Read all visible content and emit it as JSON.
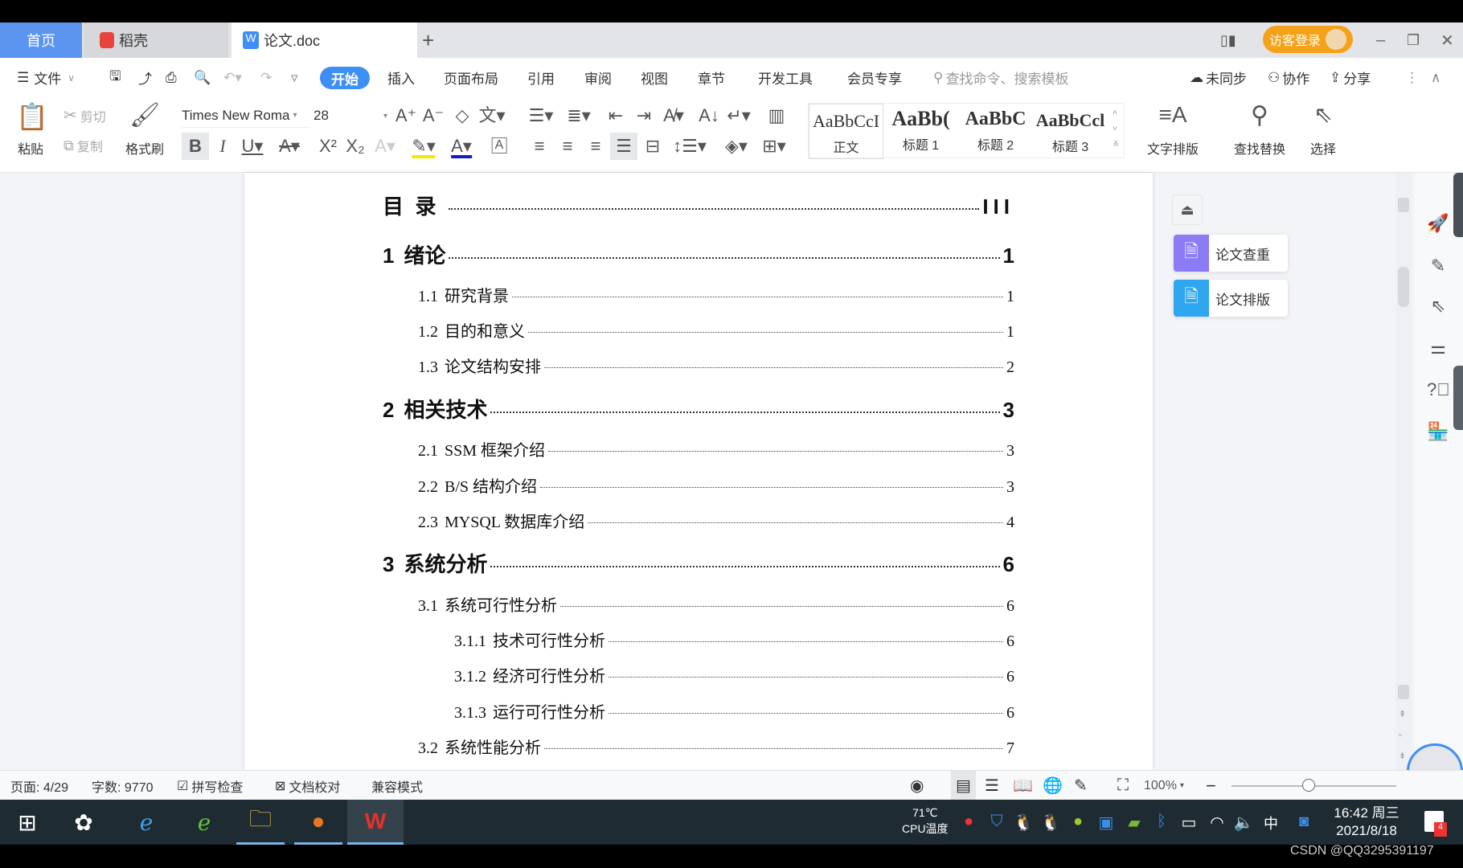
{
  "tabs": {
    "home": "首页",
    "docer": "稻壳",
    "doc": "论文.doc",
    "new": "+",
    "login": "访客登录"
  },
  "menu": {
    "file": "文件",
    "items": [
      "开始",
      "插入",
      "页面布局",
      "引用",
      "审阅",
      "视图",
      "章节",
      "开发工具",
      "会员专享"
    ],
    "search_placeholder": "查找命令、搜索模板",
    "sync": "未同步",
    "collab": "协作",
    "share": "分享"
  },
  "toolbar": {
    "paste": "粘贴",
    "cut": "剪切",
    "copy": "复制",
    "format_painter": "格式刷",
    "font": "Times New Roma",
    "size": "28",
    "styles": [
      {
        "sample": "AaBbCcI",
        "name": "正文"
      },
      {
        "sample": "AaBb(",
        "name": "标题 1"
      },
      {
        "sample": "AaBbC",
        "name": "标题 2"
      },
      {
        "sample": "AaBbCcl",
        "name": "标题 3"
      }
    ],
    "text_layout": "文字排版",
    "find_replace": "查找替换",
    "select": "选择"
  },
  "toc": [
    {
      "level": 1,
      "num": "目  录",
      "title": "",
      "page": "III"
    },
    {
      "level": 1,
      "num": "1",
      "title": "绪论",
      "page": "1"
    },
    {
      "level": 2,
      "num": "1.1",
      "title": "研究背景",
      "page": "1"
    },
    {
      "level": 2,
      "num": "1.2",
      "title": "目的和意义",
      "page": "1"
    },
    {
      "level": 2,
      "num": "1.3",
      "title": "论文结构安排",
      "page": "2"
    },
    {
      "level": 1,
      "num": "2",
      "title": "相关技术",
      "page": "3"
    },
    {
      "level": 2,
      "num": "2.1",
      "title": "SSM 框架介绍",
      "page": "3"
    },
    {
      "level": 2,
      "num": "2.2",
      "title": "B/S 结构介绍",
      "page": "3"
    },
    {
      "level": 2,
      "num": "2.3",
      "title": "MYSQL 数据库介绍",
      "page": "4"
    },
    {
      "level": 1,
      "num": "3",
      "title": "系统分析",
      "page": "6"
    },
    {
      "level": 2,
      "num": "3.1",
      "title": "系统可行性分析",
      "page": "6"
    },
    {
      "level": 3,
      "num": "3.1.1",
      "title": "技术可行性分析",
      "page": "6"
    },
    {
      "level": 3,
      "num": "3.1.2",
      "title": "经济可行性分析",
      "page": "6"
    },
    {
      "level": 3,
      "num": "3.1.3",
      "title": "运行可行性分析",
      "page": "6"
    },
    {
      "level": 2,
      "num": "3.2",
      "title": "系统性能分析",
      "page": "7"
    }
  ],
  "right_panel": {
    "check": "论文查重",
    "format": "论文排版",
    "check_color": "#8b7cf6",
    "format_color": "#2ea6f0"
  },
  "status": {
    "page": "页面: 4/29",
    "words": "字数: 9770",
    "spell": "拼写检查",
    "proof": "文档校对",
    "compat": "兼容模式",
    "zoom": "100%",
    "zoom_level": 100
  },
  "taskbar": {
    "cpu_temp": "71℃",
    "cpu_label": "CPU温度",
    "time": "16:42 周三",
    "date": "2021/8/18",
    "ime": "中",
    "notifications": "4"
  },
  "watermark": "CSDN @QQ3295391197",
  "colors": {
    "accent": "#3d8ef5",
    "home_tab": "#5b95f0",
    "login": "#f5a21b",
    "taskbar": "#1e2b33"
  }
}
